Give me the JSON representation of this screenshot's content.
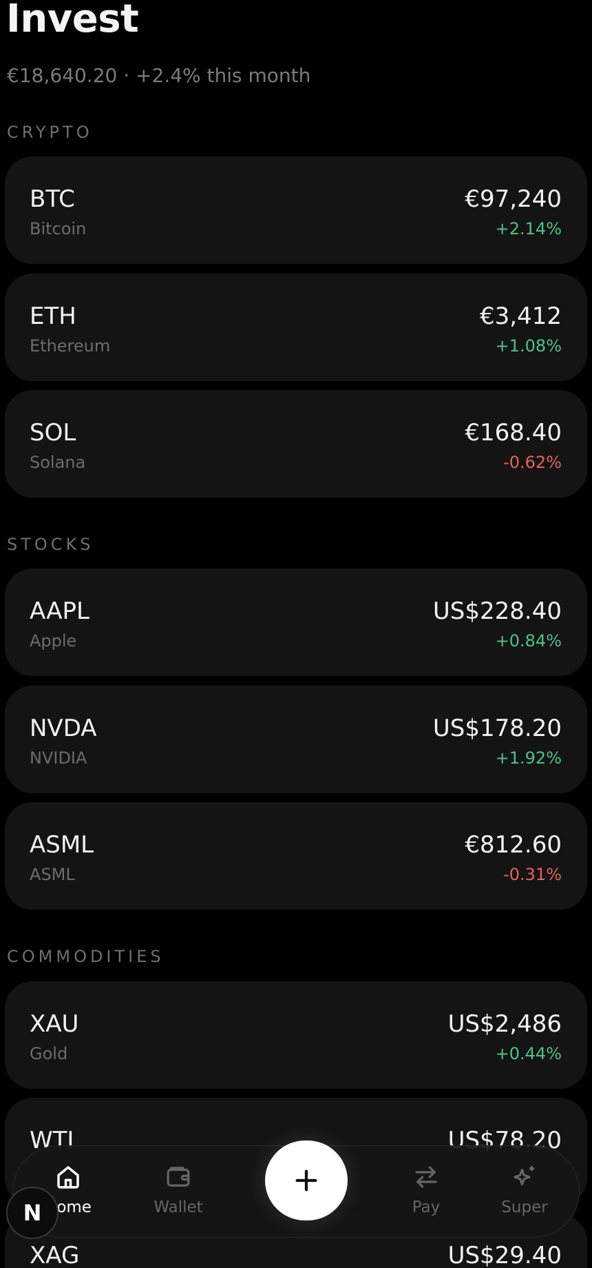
{
  "header": {
    "title": "Invest",
    "subtitle": "€18,640.20 · +2.4% this month"
  },
  "sections": {
    "crypto": "CRYPTO",
    "stocks": "STOCKS",
    "commodities": "COMMODITIES"
  },
  "assets": [
    {
      "symbol": "BTC",
      "name": "Bitcoin",
      "price": "€97,240",
      "change": "+2.14%",
      "direction": "up"
    },
    {
      "symbol": "ETH",
      "name": "Ethereum",
      "price": "€3,412",
      "change": "+1.08%",
      "direction": "up"
    },
    {
      "symbol": "SOL",
      "name": "Solana",
      "price": "€168.40",
      "change": "-0.62%",
      "direction": "down"
    },
    {
      "symbol": "AAPL",
      "name": "Apple",
      "price": "US$228.40",
      "change": "+0.84%",
      "direction": "up"
    },
    {
      "symbol": "NVDA",
      "name": "NVIDIA",
      "price": "US$178.20",
      "change": "+1.92%",
      "direction": "up"
    },
    {
      "symbol": "ASML",
      "name": "ASML",
      "price": "€812.60",
      "change": "-0.31%",
      "direction": "down"
    },
    {
      "symbol": "XAU",
      "name": "Gold",
      "price": "US$2,486",
      "change": "+0.44%",
      "direction": "up"
    },
    {
      "symbol": "WTI",
      "name": "",
      "price": "US$78.20",
      "change": "",
      "direction": "up"
    },
    {
      "symbol": "XAG",
      "name": "",
      "price": "US$29.40",
      "change": "",
      "direction": "up"
    }
  ],
  "nav": {
    "home": "Home",
    "wallet": "Wallet",
    "pay": "Pay",
    "super": "Super",
    "icons": {
      "home": "home-icon",
      "wallet": "wallet-icon",
      "add": "plus-icon",
      "pay": "transfer-arrows-icon",
      "super": "sparkle-icon"
    }
  },
  "badge": {
    "letter": "N"
  },
  "colors": {
    "background": "#000000",
    "card": "#141414",
    "positive": "#4cc38a",
    "negative": "#e5625a",
    "muted": "#6c6c6c"
  }
}
